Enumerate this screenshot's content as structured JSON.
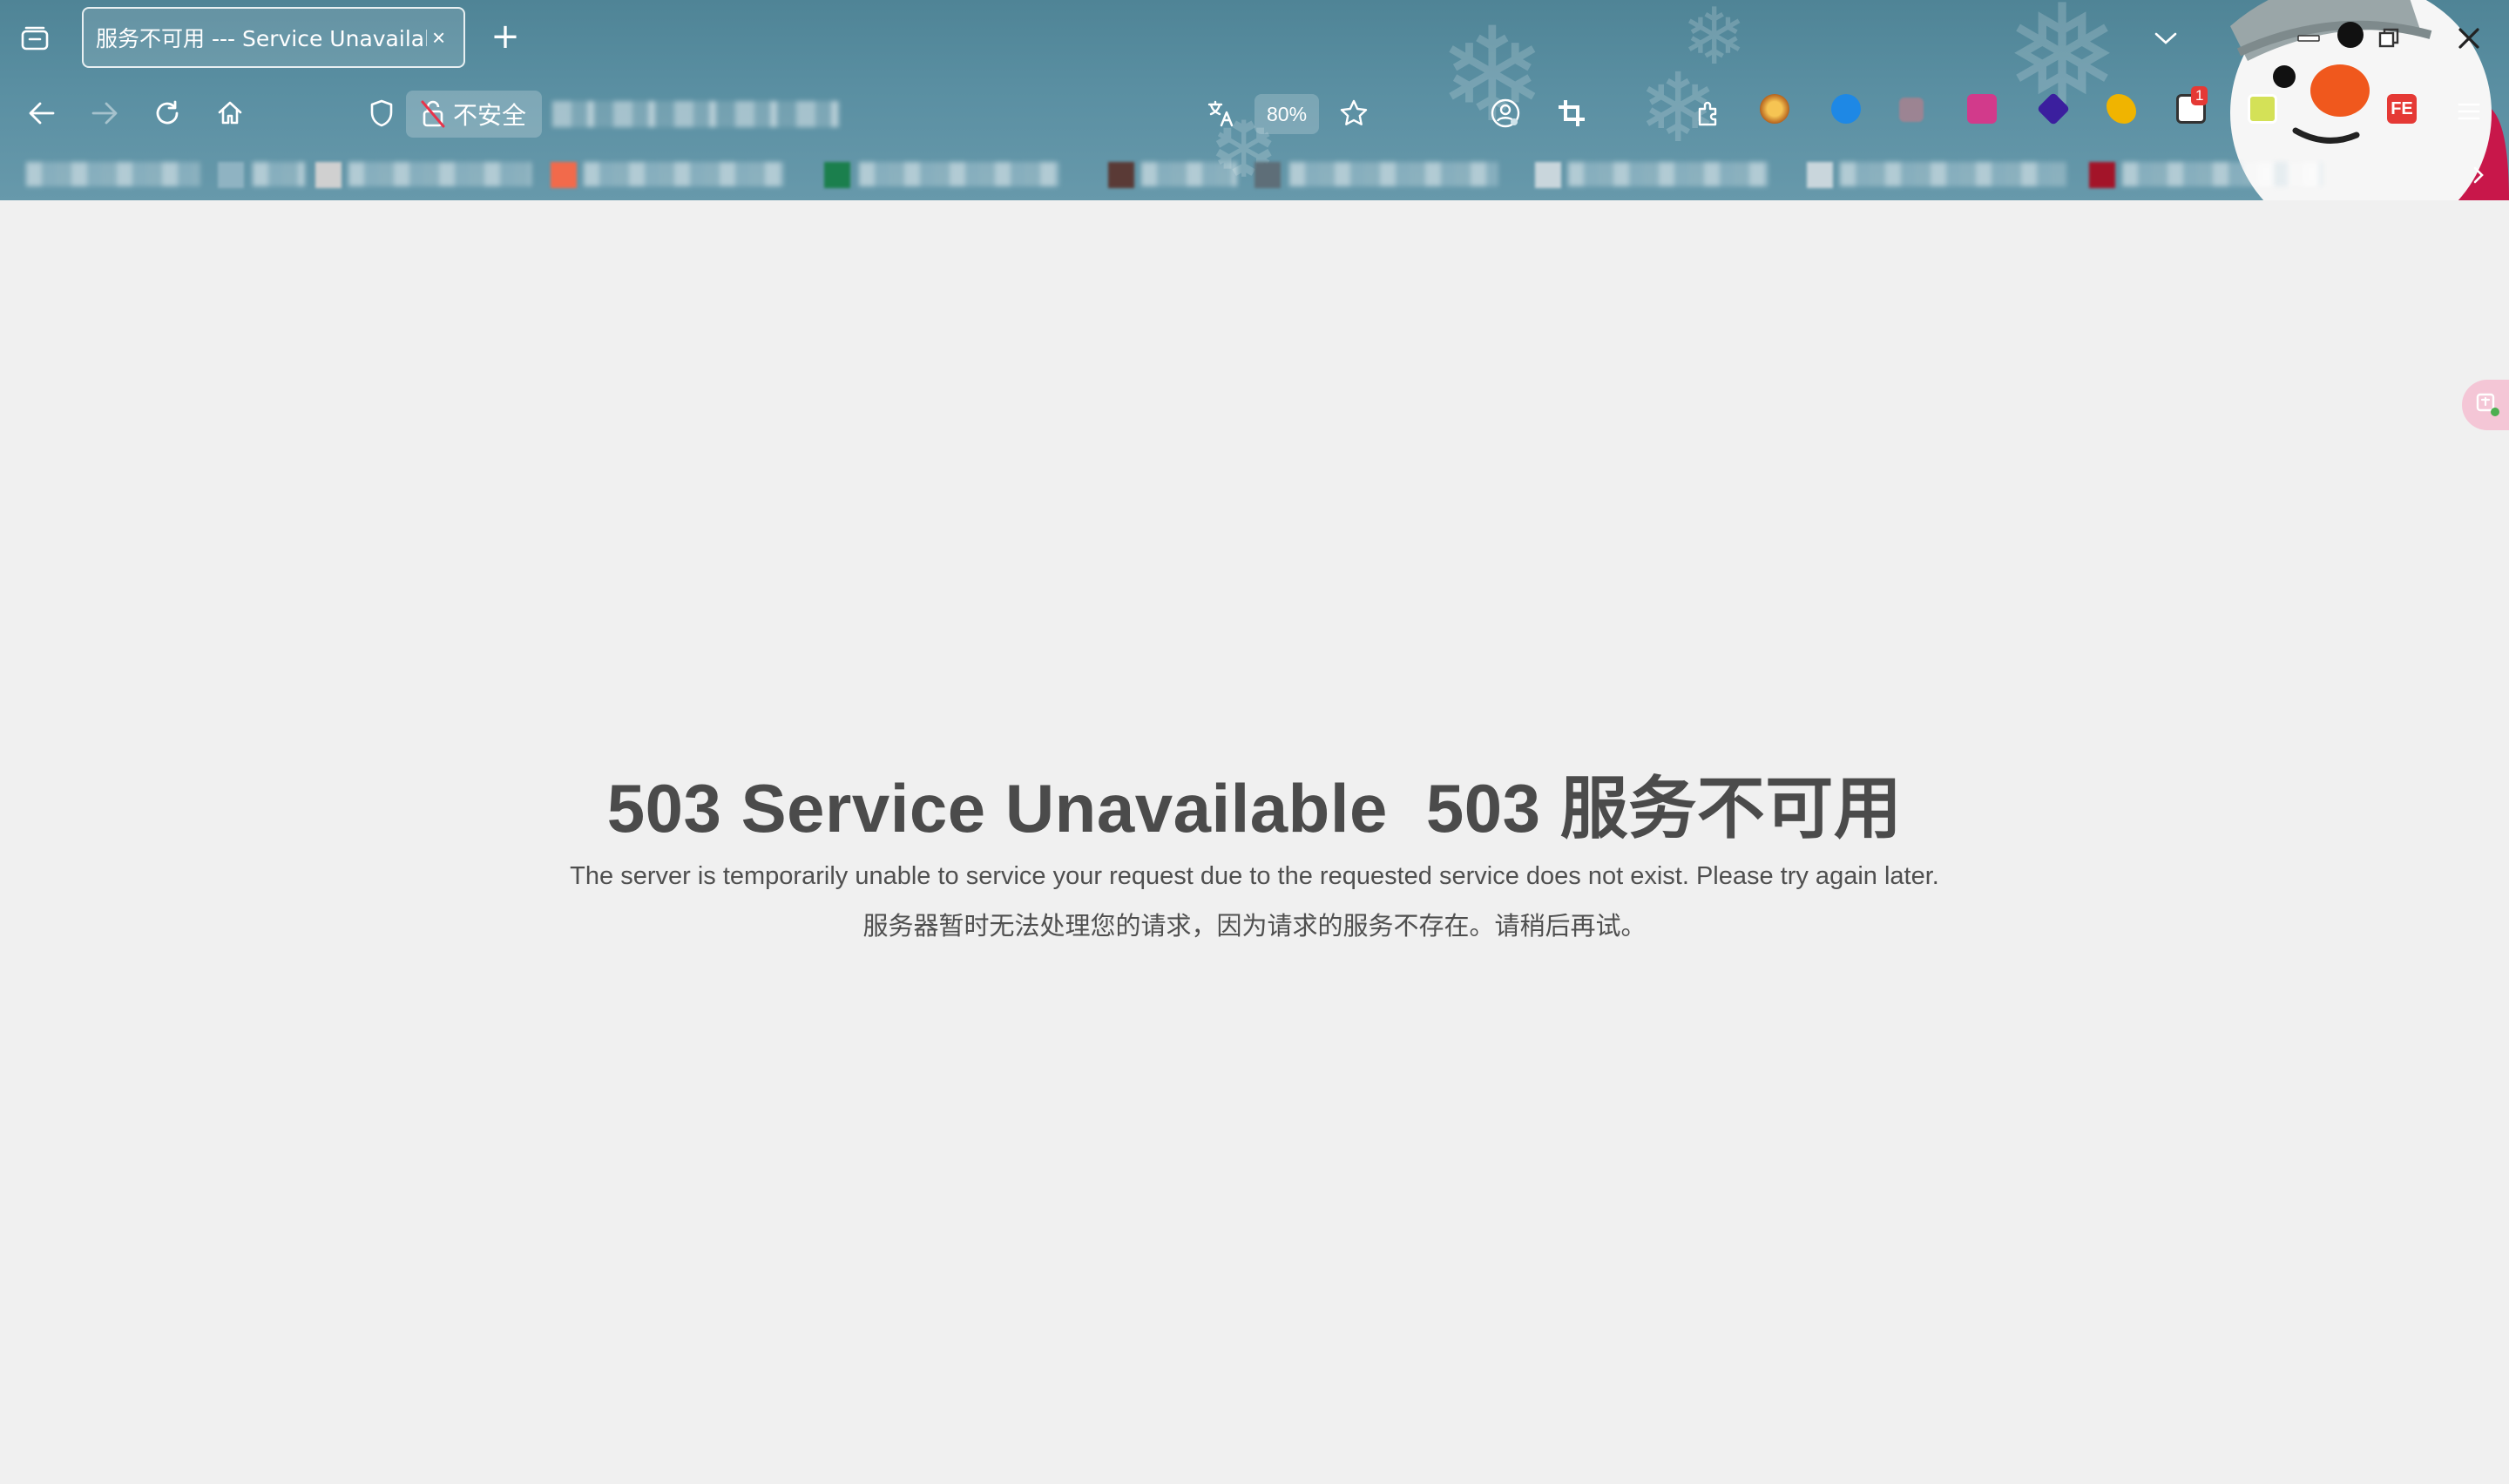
{
  "browser": {
    "tab": {
      "title": "服务不可用 --- Service Unavailable",
      "close_glyph": "×"
    },
    "new_tab_glyph": "+",
    "security_label": "不安全",
    "zoom_level": "80%",
    "extension_badge_count": "1",
    "extension_fe_label": "FE",
    "icons": [
      "tab-overview-icon",
      "back-arrow-icon",
      "forward-arrow-icon",
      "reload-icon",
      "home-icon",
      "shield-icon",
      "insecure-lock-icon",
      "translate-icon",
      "star-icon",
      "account-icon",
      "crop-icon",
      "extensions-puzzle-icon",
      "menu-icon",
      "minimize-icon",
      "restore-icon",
      "close-icon",
      "chevron-down-icon",
      "bookmarks-next-icon"
    ]
  },
  "page": {
    "heading_en": "503 Service Unavailable",
    "heading_cn": "503 服务不可用",
    "message_en": "The server is temporarily unable to service your request due to the requested service does not exist. Please try again later.",
    "message_cn": "服务器暂时无法处理您的请求，因为请求的服务不存在。请稍后再试。"
  },
  "colors": {
    "chrome_bg": "#5a8fa2",
    "page_bg": "#f0f0f0",
    "heading": "#4b4b4b",
    "text": "#4f4f4f"
  }
}
